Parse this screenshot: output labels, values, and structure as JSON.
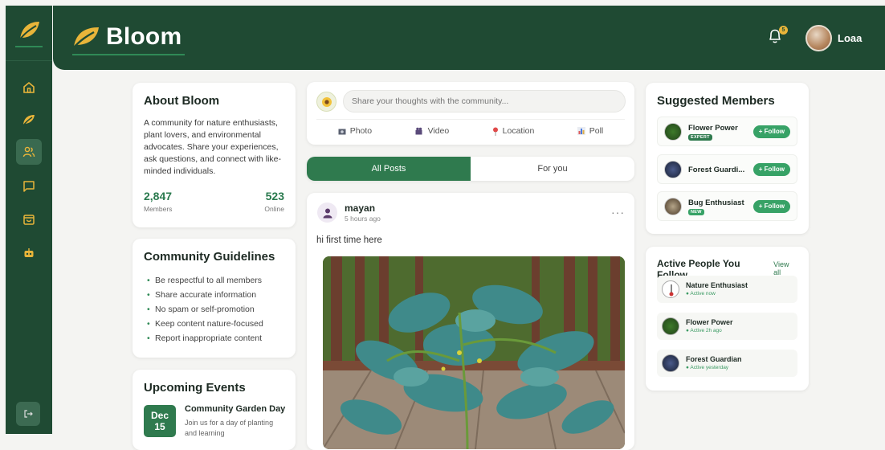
{
  "app": {
    "name": "Bloom"
  },
  "user": {
    "name": "Loaa",
    "notifications": "5"
  },
  "nav": [
    {
      "icon": "home-icon"
    },
    {
      "icon": "leaf-icon"
    },
    {
      "icon": "users-icon",
      "active": true
    },
    {
      "icon": "chat-icon"
    },
    {
      "icon": "shopping-bag-icon"
    },
    {
      "icon": "robot-icon"
    }
  ],
  "about": {
    "title": "About Bloom",
    "description": "A community for nature enthusiasts, plant lovers, and environmental advocates. Share your experiences, ask questions, and connect with like-minded individuals.",
    "members_value": "2,847",
    "members_label": "Members",
    "online_value": "523",
    "online_label": "Online"
  },
  "guidelines": {
    "title": "Community Guidelines",
    "items": [
      "Be respectful to all members",
      "Share accurate information",
      "No spam or self-promotion",
      "Keep content nature-focused",
      "Report inappropriate content"
    ]
  },
  "events": {
    "title": "Upcoming Events",
    "month": "Dec",
    "day": "15",
    "event_title": "Community Garden Day",
    "event_desc": "Join us for a day of planting and learning"
  },
  "composer": {
    "placeholder": "Share your thoughts with the community...",
    "actions": [
      "Photo",
      "Video",
      "Location",
      "Poll"
    ]
  },
  "tabs": [
    "All Posts",
    "For you"
  ],
  "post": {
    "author": "mayan",
    "time": "5 hours ago",
    "text": "hi first time here",
    "more": "···"
  },
  "suggested": {
    "title": "Suggested Members",
    "follow_label": "Follow",
    "items": [
      {
        "name": "Flower Power",
        "badge": "EXPERT"
      },
      {
        "name": "Forest Guardi...",
        "badge": ""
      },
      {
        "name": "Bug Enthusiast",
        "badge": "NEW"
      }
    ]
  },
  "active_people": {
    "title": "Active People You Follow",
    "view_all": "View all",
    "items": [
      {
        "name": "Nature Enthusiast",
        "status": "● Active now"
      },
      {
        "name": "Flower Power",
        "status": "● Active 2h ago"
      },
      {
        "name": "Forest Guardian",
        "status": "● Active yesterday"
      }
    ]
  },
  "colors": {
    "primary": "#1f4a33",
    "accent": "#2f7a4e",
    "brand_leaf": "#e9b53a"
  }
}
